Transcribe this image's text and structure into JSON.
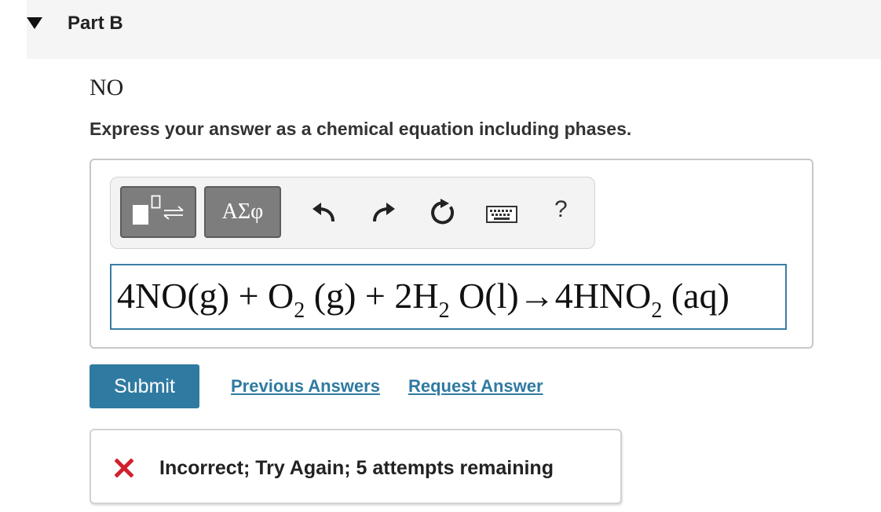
{
  "part": {
    "title": "Part B",
    "toggle_icon": "triangle-down-icon"
  },
  "question": {
    "species": "NO",
    "instructions": "Express your answer as a chemical equation including phases."
  },
  "toolbar": {
    "templates_icon": "templates-icon",
    "symbols_label": "ΑΣφ",
    "undo_icon": "undo-icon",
    "redo_icon": "redo-icon",
    "reset_icon": "reset-icon",
    "keyboard_icon": "keyboard-icon",
    "help_label": "?"
  },
  "answer": {
    "eq_part1": "4NO(g) + O",
    "sub_o": "2",
    "eq_part2": " (g) + 2H",
    "sub_h": "2",
    "eq_part3": " O(l)→4HNO",
    "sub_hno": "2",
    "eq_part4": " (aq)"
  },
  "actions": {
    "submit_label": "Submit",
    "previous_answers_label": "Previous Answers",
    "request_answer_label": "Request Answer"
  },
  "feedback": {
    "icon": "x-mark-icon",
    "text": "Incorrect; Try Again; 5 attempts remaining"
  },
  "colors": {
    "accent": "#2f7aa1",
    "error": "#d0202a",
    "toolbar_button": "#7d7d7d",
    "header_bg": "#f5f5f5"
  }
}
